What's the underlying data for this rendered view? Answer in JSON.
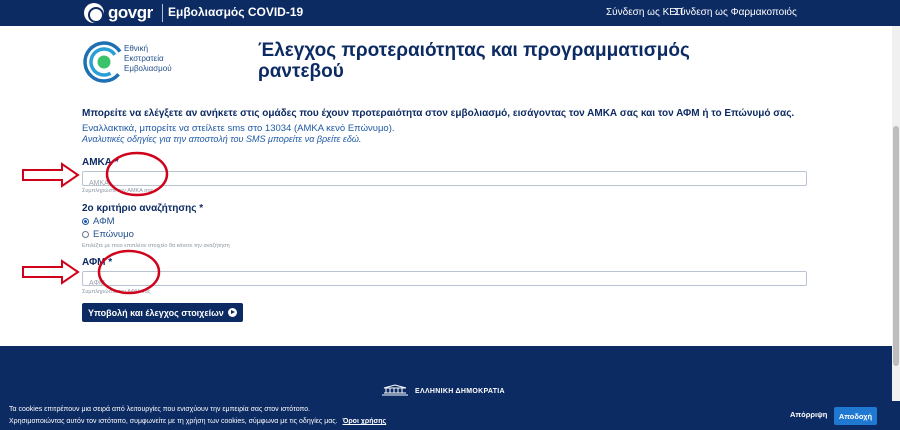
{
  "header": {
    "logo_text": "govgr",
    "app_title": "Εμβολιασμός COVID-19",
    "links": [
      "Σύνδεση ως ΚΕΠ",
      "Σύνδεση ως Φαρμακοποιός"
    ]
  },
  "org": {
    "name_line1": "Εθνική",
    "name_line2": "Εκστρατεία",
    "name_line3": "Εμβολιασμού"
  },
  "page": {
    "title_line1": "Έλεγχος προτεραιότητας και προγραμματισμός",
    "title_line2": "ραντεβού",
    "intro_bold": "Μπορείτε να ελέγξετε αν ανήκετε στις ομάδες που έχουν προτεραιότητα στον εμβολιασμό, εισάγοντας τον ΑΜΚΑ σας και τον ΑΦΜ ή το Επώνυμό σας.",
    "intro_sms": "Εναλλακτικά, μπορείτε να στείλετε sms στο 13034 (ΑΜΚΑ κενό Επώνυμο).",
    "intro_italic": "Αναλυτικές οδηγίες για την αποστολή του SMS μπορείτε να βρείτε εδώ."
  },
  "form": {
    "amka_label": "ΑΜΚΑ *",
    "amka_placeholder": "ΑΜΚΑ",
    "amka_hint": "Συμπληρώστε τον ΑΜΚΑ σας",
    "criterion_label": "2ο κριτήριο αναζήτησης *",
    "options": [
      "ΑΦΜ",
      "Επώνυμο"
    ],
    "selected_option": "ΑΦΜ",
    "criterion_hint": "Επιλέξτε με ποιο επιπλέον στοιχείο θα κάνετε την αναζήτηση",
    "afm_label": "ΑΦΜ *",
    "afm_placeholder": "ΑΦΜ",
    "afm_hint": "Συμπληρώστε τον ΑΦΜ σας",
    "submit_label": "Υποβολή και έλεγχος στοιχείων"
  },
  "footer": {
    "republic": "ΕΛΛΗΝΙΚΗ ΔΗΜΟΚΡΑΤΙΑ"
  },
  "cookies": {
    "line1": "Τα cookies επιτρέπουν μια σειρά από λειτουργίες που ενισχύουν την εμπειρία σας στον ιστότοπο.",
    "line2": "Χρησιμοποιώντας αυτόν τον ιστότοπο, συμφωνείτε με τη χρήση των cookies, σύμφωνα με τις οδηγίες μας.",
    "terms_link": "Όροι χρήσης",
    "reject_label": "Απόρριψη",
    "accept_label": "Αποδοχή"
  },
  "colors": {
    "navy": "#0d2b63",
    "link_blue": "#1f5aa6",
    "accept_blue": "#1f78d1",
    "annotation_red": "#d0021b"
  }
}
